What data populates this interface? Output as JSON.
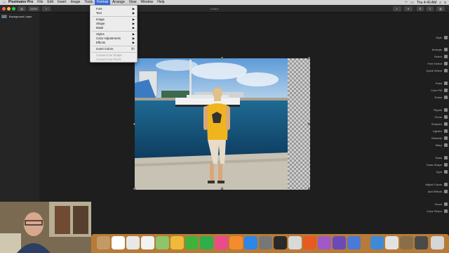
{
  "menubar": {
    "items": [
      "Pixelmator Pro",
      "File",
      "Edit",
      "Insert",
      "Image",
      "Tools",
      "Format",
      "Arrange",
      "View",
      "Window",
      "Help"
    ],
    "active": "Format",
    "time": "Thu 4:40 AM"
  },
  "toolbar": {
    "zoom": "100%",
    "doc_title": "Edited"
  },
  "sidebar": {
    "layer_name": "Background Layer"
  },
  "format_menu": {
    "items": [
      {
        "label": "Font",
        "arrow": "▶",
        "disabled": false
      },
      {
        "label": "Text",
        "arrow": "▶",
        "disabled": false
      },
      {
        "label": "Image",
        "arrow": "▶",
        "disabled": false
      },
      {
        "label": "Shape",
        "arrow": "▶",
        "disabled": false
      },
      {
        "label": "Mask",
        "arrow": "▶",
        "disabled": false
      },
      {
        "label": "Styles",
        "arrow": "▶",
        "disabled": false
      },
      {
        "label": "Color Adjustments",
        "arrow": "▶",
        "disabled": false
      },
      {
        "label": "Effects",
        "arrow": "▶",
        "disabled": false
      },
      {
        "label": "Invert Colors",
        "shortcut": "⌘I",
        "disabled": false
      },
      {
        "label": "Convert into Shape",
        "disabled": true
      },
      {
        "label": "Convert into Pixels",
        "disabled": true
      }
    ]
  },
  "tools": {
    "items": [
      "Style",
      "Arrange",
      "Select",
      "Free Select",
      "Quick Select",
      "Paint",
      "Color Fill",
      "Erase",
      "Repair",
      "Clone",
      "Sharpen",
      "Lighten",
      "Saturate",
      "Warp",
      "Draw",
      "Draw Shape",
      "Type",
      "Adjust Colors",
      "Add Effects",
      "Zoom",
      "Color Picker"
    ]
  },
  "colors": {
    "accent": "#3a6fd8",
    "dock": "#d28c3c"
  }
}
